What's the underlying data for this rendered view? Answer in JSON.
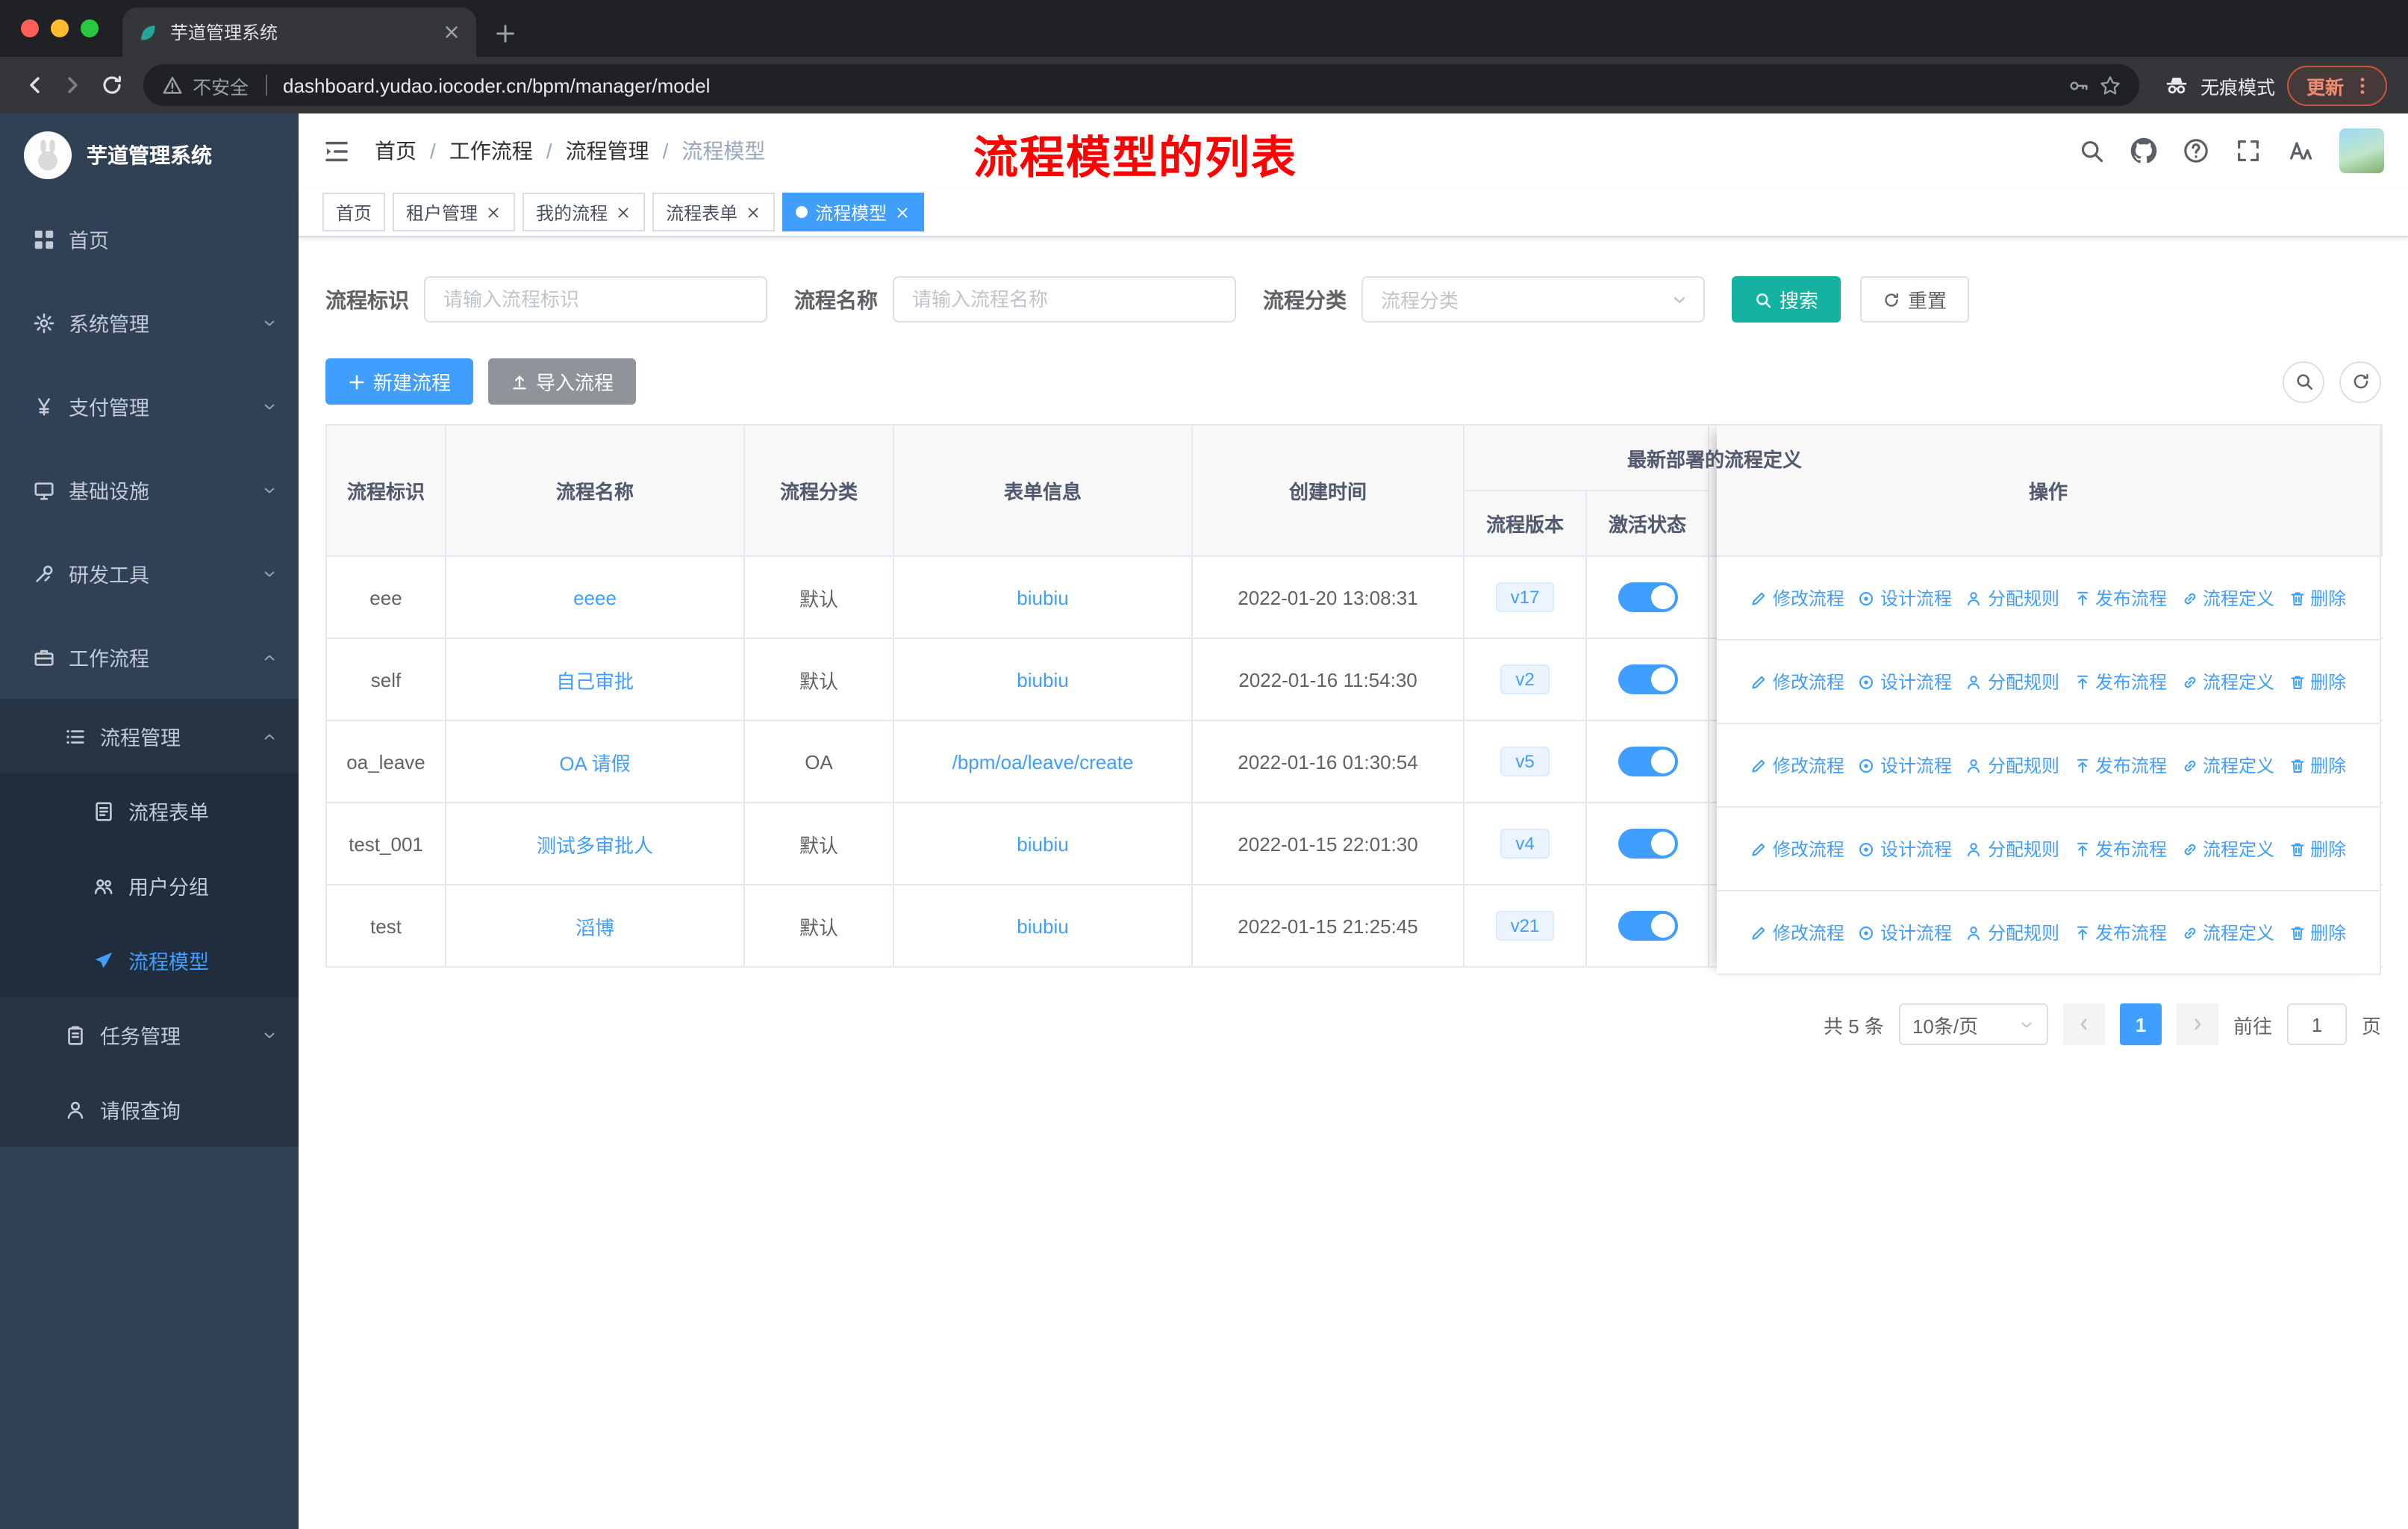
{
  "colors": {
    "primary": "#409eff",
    "search_button": "#14b3a1",
    "annotation_red": "#fe0100",
    "sidebar_bg": "#304156",
    "toggle_on": "#409eff",
    "active_tag": "#409eff"
  },
  "browser": {
    "tab": {
      "title": "芋道管理系统"
    },
    "address": {
      "security": "不安全",
      "url": "dashboard.yudao.iocoder.cn/bpm/manager/model"
    },
    "incognito": "无痕模式",
    "update": "更新"
  },
  "sidebar": {
    "title": "芋道管理系统",
    "items": [
      {
        "id": "home",
        "label": "首页",
        "icon": "dashboard-icon",
        "level": 1
      },
      {
        "id": "system",
        "label": "系统管理",
        "icon": "gear-icon",
        "level": 1,
        "chevron": "down"
      },
      {
        "id": "payment",
        "label": "支付管理",
        "icon": "yen-icon",
        "level": 1,
        "chevron": "down"
      },
      {
        "id": "infrastructure",
        "label": "基础设施",
        "icon": "monitor-icon",
        "level": 1,
        "chevron": "down"
      },
      {
        "id": "devtools",
        "label": "研发工具",
        "icon": "tools-icon",
        "level": 1,
        "chevron": "down"
      },
      {
        "id": "workflow",
        "label": "工作流程",
        "icon": "briefcase-icon",
        "level": 1,
        "chevron": "up"
      },
      {
        "id": "process-manage",
        "label": "流程管理",
        "icon": "list-icon",
        "level": 2,
        "chevron": "up"
      },
      {
        "id": "process-form",
        "label": "流程表单",
        "icon": "form-icon",
        "level": 3
      },
      {
        "id": "user-group",
        "label": "用户分组",
        "icon": "group-icon",
        "level": 3
      },
      {
        "id": "process-model",
        "label": "流程模型",
        "icon": "send-icon",
        "level": 3,
        "active": true
      },
      {
        "id": "task-manage",
        "label": "任务管理",
        "icon": "task-icon",
        "level": 2,
        "chevron": "down"
      },
      {
        "id": "leave-query",
        "label": "请假查询",
        "icon": "user-icon",
        "level": 2
      }
    ]
  },
  "header": {
    "breadcrumb": [
      "首页",
      "工作流程",
      "流程管理",
      "流程模型"
    ],
    "annotation": "流程模型的列表",
    "right_icons": [
      "search-icon",
      "github-icon",
      "question-icon",
      "fullscreen-icon",
      "font-size-icon"
    ]
  },
  "tags": [
    {
      "id": "home",
      "label": "首页"
    },
    {
      "id": "tenant-manage",
      "label": "租户管理",
      "closable": true
    },
    {
      "id": "my-process",
      "label": "我的流程",
      "closable": true
    },
    {
      "id": "process-form",
      "label": "流程表单",
      "closable": true
    },
    {
      "id": "process-model",
      "label": "流程模型",
      "closable": true,
      "active": true
    }
  ],
  "filters": {
    "key": {
      "label": "流程标识",
      "placeholder": "请输入流程标识"
    },
    "name": {
      "label": "流程名称",
      "placeholder": "请输入流程名称"
    },
    "category": {
      "label": "流程分类",
      "placeholder": "流程分类"
    },
    "search_label": "搜索",
    "reset_label": "重置"
  },
  "toolbar": {
    "create_label": "新建流程",
    "import_label": "导入流程"
  },
  "table": {
    "headers": {
      "key": "流程标识",
      "name": "流程名称",
      "category": "流程分类",
      "form": "表单信息",
      "created": "创建时间",
      "group": "最新部署的流程定义",
      "version": "流程版本",
      "status": "激活状态",
      "ops": "操作"
    },
    "rows": [
      {
        "key": "eee",
        "name": "eeee",
        "category": "默认",
        "form": "biubiu",
        "created": "2022-01-20 13:08:31",
        "version": "v17",
        "active": true
      },
      {
        "key": "self",
        "name": "自己审批",
        "category": "默认",
        "form": "biubiu",
        "created": "2022-01-16 11:54:30",
        "version": "v2",
        "active": true
      },
      {
        "key": "oa_leave",
        "name": "OA 请假",
        "category": "OA",
        "form": "/bpm/oa/leave/create",
        "created": "2022-01-16 01:30:54",
        "version": "v5",
        "active": true
      },
      {
        "key": "test_001",
        "name": "测试多审批人",
        "category": "默认",
        "form": "biubiu",
        "created": "2022-01-15 22:01:30",
        "version": "v4",
        "active": true
      },
      {
        "key": "test",
        "name": "滔博",
        "category": "默认",
        "form": "biubiu",
        "created": "2022-01-15 21:25:45",
        "version": "v21",
        "active": true
      }
    ],
    "actions": [
      {
        "id": "modify",
        "label": "修改流程",
        "icon": "edit-icon"
      },
      {
        "id": "design",
        "label": "设计流程",
        "icon": "design-icon"
      },
      {
        "id": "assign-rule",
        "label": "分配规则",
        "icon": "assign-icon"
      },
      {
        "id": "publish",
        "label": "发布流程",
        "icon": "publish-icon"
      },
      {
        "id": "definition",
        "label": "流程定义",
        "icon": "definition-icon"
      },
      {
        "id": "delete",
        "label": "删除",
        "icon": "delete-icon"
      }
    ]
  },
  "pagination": {
    "total": "共 5 条",
    "page_size": "10条/页",
    "current": "1",
    "goto_label": "前往",
    "goto_value": "1",
    "unit": "页"
  }
}
